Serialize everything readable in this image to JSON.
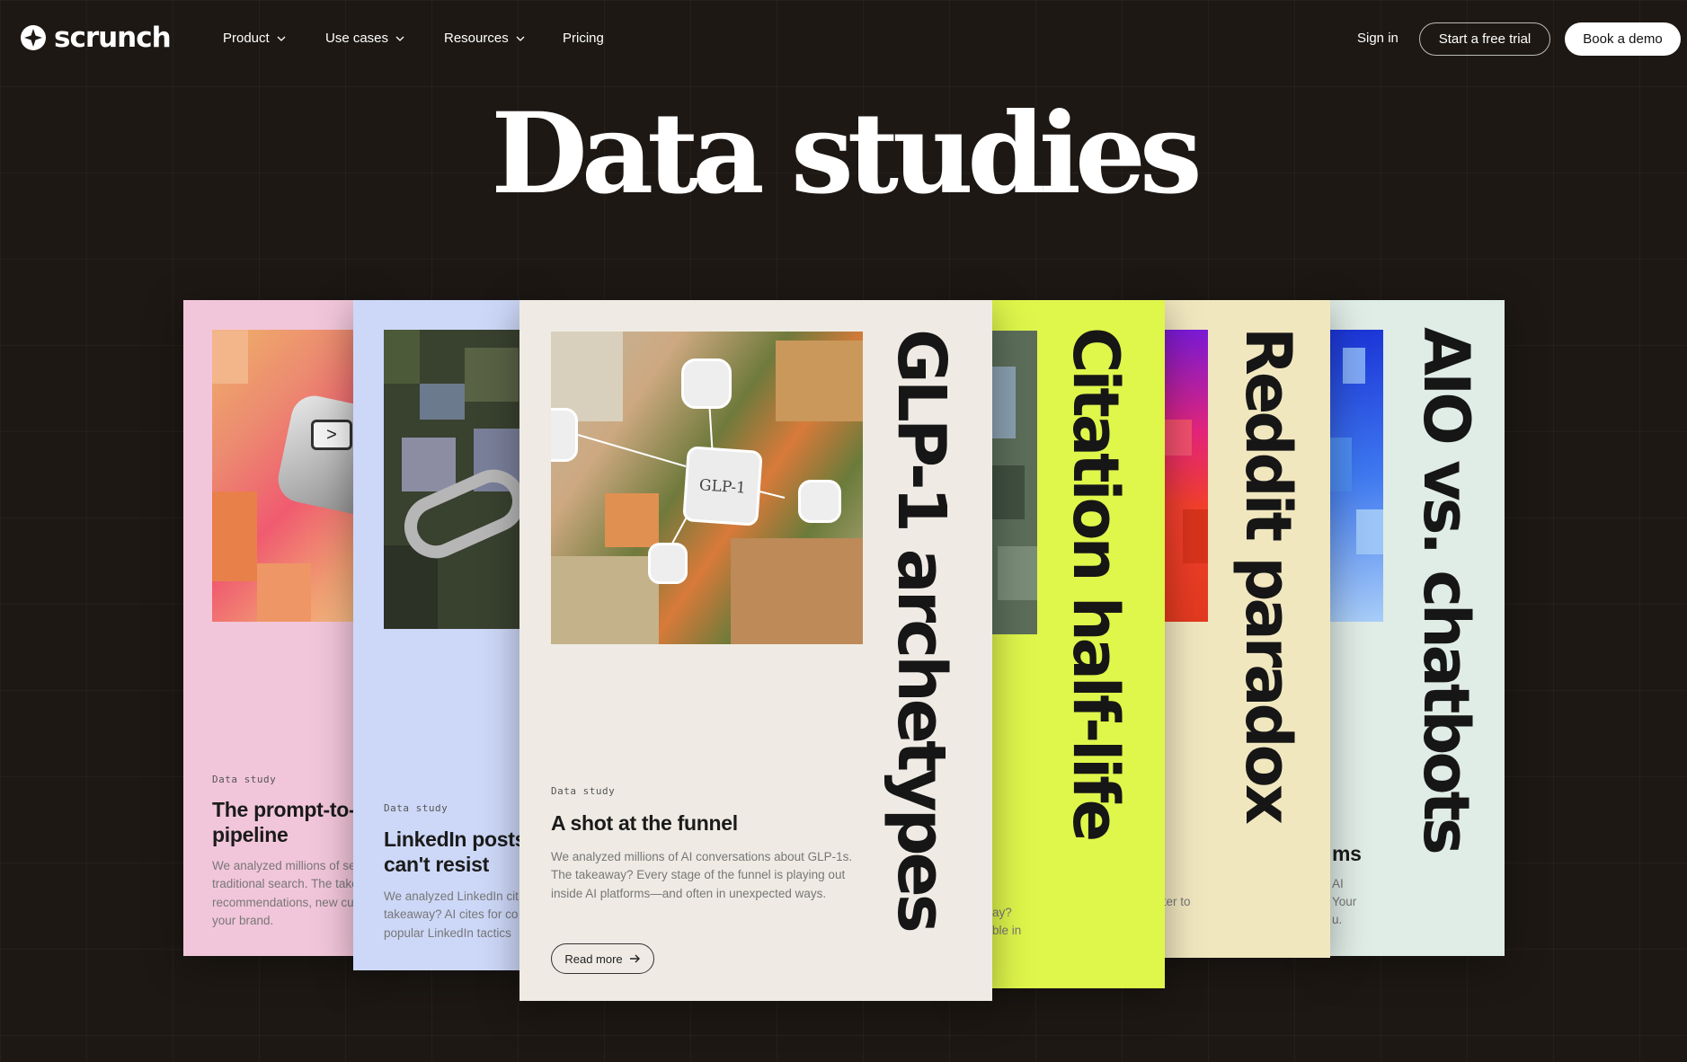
{
  "brand": {
    "name": "scrunch"
  },
  "nav": {
    "items": [
      {
        "label": "Product"
      },
      {
        "label": "Use cases"
      },
      {
        "label": "Resources"
      },
      {
        "label": "Pricing"
      }
    ],
    "sign_in": "Sign in",
    "trial": "Start a free trial",
    "demo": "Book a demo"
  },
  "page": {
    "title": "Data studies"
  },
  "cards": [
    {
      "tag": "Data study",
      "heading": "The prompt-to-pipeline",
      "body": "We analyzed millions of se traditional search. The take recommendations, new cu your brand."
    },
    {
      "tag": "Data study",
      "heading": "LinkedIn posts can't resist",
      "body": "We analyzed LinkedIn cit takeaway? AI cites for co popular LinkedIn tactics"
    },
    {
      "tag": "Data study",
      "heading": "A shot at the funnel",
      "body": "We analyzed millions of AI conversations about GLP-1s. The takeaway? Every stage of the funnel is playing out inside AI platforms—and often in unexpected ways.",
      "vertical": "GLP-1 archetypes",
      "read_more": "Read more",
      "image_label": "GLP-1"
    },
    {
      "vertical": "Citation half-life",
      "body_fragment_1": "ay?",
      "body_fragment_2": "ble in"
    },
    {
      "vertical": "Reddit paradox",
      "body_fragment": "tter to"
    },
    {
      "vertical": "AIO vs. chatbots",
      "heading_fragment": "ms",
      "body_fragment_1": "AI",
      "body_fragment_2": "Your",
      "body_fragment_3": "u."
    }
  ]
}
